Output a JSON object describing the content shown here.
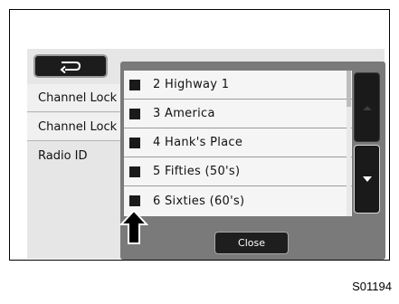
{
  "screen": {
    "background_items": [
      {
        "label": "Channel Lock"
      },
      {
        "label": "Channel Lock"
      },
      {
        "label": "Radio ID"
      }
    ]
  },
  "popup": {
    "channels": [
      {
        "label": "2  Highway 1"
      },
      {
        "label": "3  America"
      },
      {
        "label": "4  Hank's Place"
      },
      {
        "label": "5  Fifties (50's)"
      },
      {
        "label": "6  Sixties (60's)"
      }
    ],
    "close_label": "Close"
  },
  "figure": {
    "code": "S01194"
  },
  "colors": {
    "screen_bg": "#e6e6e6",
    "popup_bg": "#7a7a7a",
    "button_bg": "#1a1a1a"
  },
  "icons": {
    "back": "back-arrow-icon",
    "scroll_up": "chevron-up-icon",
    "scroll_down": "chevron-down-icon",
    "callout": "callout-arrow-icon"
  }
}
